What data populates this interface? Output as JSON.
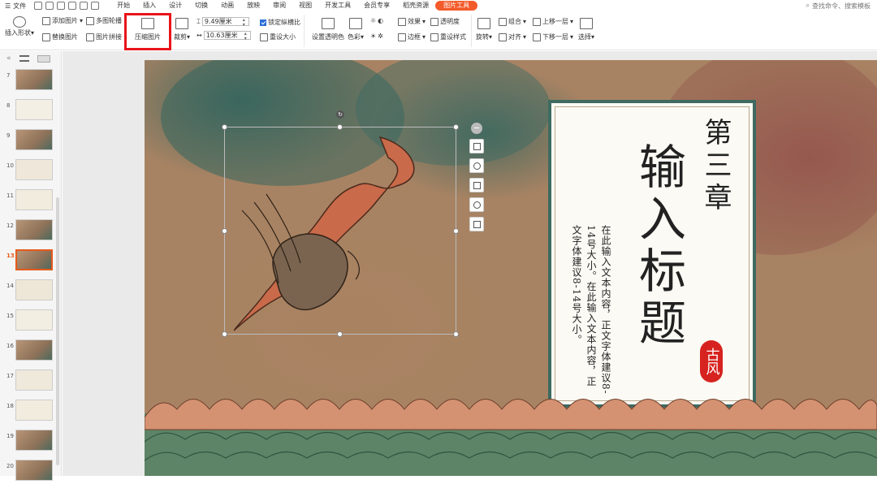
{
  "menu": {
    "file_label": "文件",
    "tabs": [
      "开始",
      "插入",
      "设计",
      "切换",
      "动画",
      "放映",
      "审阅",
      "视图",
      "开发工具",
      "会员专享",
      "稻壳资源"
    ],
    "active_tab": "图片工具",
    "search_placeholder": "查找命令、搜索模板"
  },
  "ribbon": {
    "insert_shape": "插入形状",
    "add_picture": "添加图片",
    "replace_picture": "替换图片",
    "multi_picture": "多图轮播",
    "picture_stitch": "图片拼接",
    "compress_picture": "压缩图片",
    "crop": "裁剪",
    "width_value": "9.49厘米",
    "height_value": "10.63厘米",
    "lock_ratio": "锁定纵横比",
    "reset_size": "重设大小",
    "set_transparent_color": "设置透明色",
    "color": "色彩",
    "effect": "效果",
    "transparency": "透明度",
    "border": "边框",
    "reset_style": "重设样式",
    "rotate": "旋转",
    "group": "组合",
    "align": "对齐",
    "bring_forward": "上移一层",
    "send_backward": "下移一层",
    "select": "选择"
  },
  "thumbnails": {
    "numbers": [
      "7",
      "8",
      "9",
      "10",
      "11",
      "12",
      "13",
      "14",
      "15",
      "16",
      "17",
      "18",
      "19",
      "20"
    ],
    "selected": "13"
  },
  "slide": {
    "chapter": "第三章",
    "title": "输入标题",
    "body": "在此输入文本内容，正文字体建议8-14号大小。在此输入文本内容，正文字体建议8-14号大小。",
    "seal": "古风"
  }
}
